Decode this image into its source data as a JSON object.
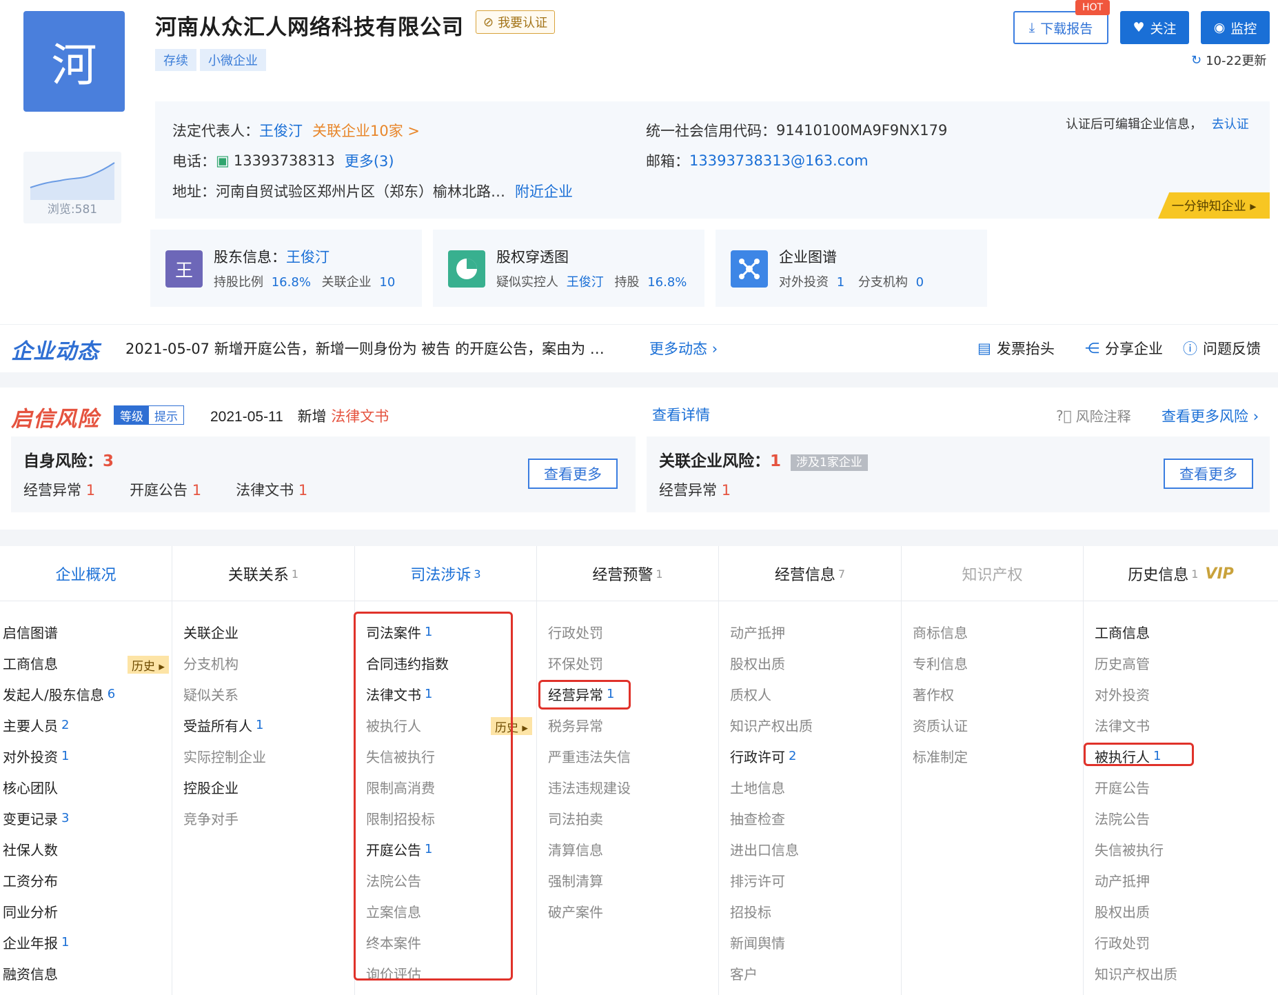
{
  "company": {
    "logo_char": "河",
    "name": "河南从众汇人网络科技有限公司",
    "verify_label": "我要认证",
    "tags": [
      "存续",
      "小微企业"
    ],
    "views": "浏览:581"
  },
  "header_actions": {
    "download": "下载报告",
    "hot": "HOT",
    "follow": "关注",
    "monitor": "监控",
    "updated": "10-22更新"
  },
  "info": {
    "legal_label": "法定代表人：",
    "legal_name": "王俊汀",
    "related": "关联企业10家 >",
    "phone_label": "电话：",
    "phone": "13393738313",
    "phone_more": "更多(3)",
    "address_label": "地址：",
    "address": "河南自贸试验区郑州片区（郑东）榆林北路…",
    "nearby": "附近企业",
    "credit_label": "统一社会信用代码：",
    "credit_code": "91410100MA9F9NX179",
    "email_label": "邮箱：",
    "email": "13393738313@163.com",
    "cert_note": "认证后可编辑企业信息，",
    "cert_link": "去认证",
    "quick": "一分钟知企业 ▸"
  },
  "cards": [
    {
      "icon_char": "王",
      "title": "股东信息：",
      "title_link": "王俊汀",
      "sub1": "持股比例",
      "val1": "16.8%",
      "sub2": "关联企业",
      "val2": "10"
    },
    {
      "title": "股权穿透图",
      "sub1": "疑似实控人",
      "val1": "王俊汀",
      "sub2": "持股",
      "val2": "16.8%"
    },
    {
      "title": "企业图谱",
      "sub1": "对外投资",
      "val1": "1",
      "sub2": "分支机构",
      "val2": "0"
    }
  ],
  "dynamics": {
    "title": "企业动态",
    "text": "2021-05-07  新增开庭公告，新增一则身份为 被告 的开庭公告，案由为 …",
    "more": "更多动态",
    "actions": [
      "发票抬头",
      "分享企业",
      "问题反馈"
    ]
  },
  "risk": {
    "title": "启信风险",
    "level": "等级",
    "hint": "提示",
    "date": "2021-05-11",
    "news_prefix": "新增",
    "news_link": "法律文书",
    "detail": "查看详情",
    "note": "风险注释",
    "more": "查看更多风险",
    "self": {
      "label": "自身风险：",
      "count": "3",
      "items": [
        [
          "经营异常",
          "1"
        ],
        [
          "开庭公告",
          "1"
        ],
        [
          "法律文书",
          "1"
        ]
      ],
      "button": "查看更多"
    },
    "related": {
      "label": "关联企业风险：",
      "count": "1",
      "badge": "涉及1家企业",
      "items": [
        [
          "经营异常",
          "1"
        ]
      ],
      "button": "查看更多"
    }
  },
  "tabs": [
    {
      "label": "企业概况",
      "count": ""
    },
    {
      "label": "关联关系",
      "count": "1"
    },
    {
      "label": "司法涉诉",
      "count": "3"
    },
    {
      "label": "经营预警",
      "count": "1"
    },
    {
      "label": "经营信息",
      "count": "7"
    },
    {
      "label": "知识产权",
      "count": ""
    },
    {
      "label": "历史信息",
      "count": "1",
      "vip": "VIP"
    }
  ],
  "hist_badge": "历史 ▸",
  "columns": [
    [
      [
        "启信图谱",
        ""
      ],
      [
        "工商信息",
        ""
      ],
      [
        "发起人/股东信息",
        "6"
      ],
      [
        "主要人员",
        "2"
      ],
      [
        "对外投资",
        "1"
      ],
      [
        "核心团队",
        ""
      ],
      [
        "变更记录",
        "3"
      ],
      [
        "社保人数",
        ""
      ],
      [
        "工资分布",
        ""
      ],
      [
        "同业分析",
        ""
      ],
      [
        "企业年报",
        "1"
      ],
      [
        "融资信息",
        ""
      ]
    ],
    [
      [
        "关联企业",
        ""
      ],
      [
        "分支机构",
        ""
      ],
      [
        "疑似关系",
        ""
      ],
      [
        "受益所有人",
        "1"
      ],
      [
        "实际控制企业",
        ""
      ],
      [
        "控股企业",
        ""
      ],
      [
        "竞争对手",
        ""
      ]
    ],
    [
      [
        "司法案件",
        "1"
      ],
      [
        "合同违约指数",
        ""
      ],
      [
        "法律文书",
        "1"
      ],
      [
        "被执行人",
        ""
      ],
      [
        "失信被执行",
        ""
      ],
      [
        "限制高消费",
        ""
      ],
      [
        "限制招投标",
        ""
      ],
      [
        "开庭公告",
        "1"
      ],
      [
        "法院公告",
        ""
      ],
      [
        "立案信息",
        ""
      ],
      [
        "终本案件",
        ""
      ],
      [
        "询价评估",
        ""
      ]
    ],
    [
      [
        "行政处罚",
        ""
      ],
      [
        "环保处罚",
        ""
      ],
      [
        "经营异常",
        "1"
      ],
      [
        "税务异常",
        ""
      ],
      [
        "严重违法失信",
        ""
      ],
      [
        "违法违规建设",
        ""
      ],
      [
        "司法拍卖",
        ""
      ],
      [
        "清算信息",
        ""
      ],
      [
        "强制清算",
        ""
      ],
      [
        "破产案件",
        ""
      ]
    ],
    [
      [
        "动产抵押",
        ""
      ],
      [
        "股权出质",
        ""
      ],
      [
        "质权人",
        ""
      ],
      [
        "知识产权出质",
        ""
      ],
      [
        "行政许可",
        "2"
      ],
      [
        "土地信息",
        ""
      ],
      [
        "抽查检查",
        ""
      ],
      [
        "进出口信息",
        ""
      ],
      [
        "排污许可",
        ""
      ],
      [
        "招投标",
        ""
      ],
      [
        "新闻舆情",
        ""
      ],
      [
        "客户",
        ""
      ]
    ],
    [
      [
        "商标信息",
        ""
      ],
      [
        "专利信息",
        ""
      ],
      [
        "著作权",
        ""
      ],
      [
        "资质认证",
        ""
      ],
      [
        "标准制定",
        ""
      ]
    ],
    [
      [
        "工商信息",
        ""
      ],
      [
        "历史高管",
        ""
      ],
      [
        "对外投资",
        ""
      ],
      [
        "法律文书",
        ""
      ],
      [
        "被执行人",
        "1"
      ],
      [
        "开庭公告",
        ""
      ],
      [
        "法院公告",
        ""
      ],
      [
        "失信被执行",
        ""
      ],
      [
        "动产抵押",
        ""
      ],
      [
        "股权出质",
        ""
      ],
      [
        "行政处罚",
        ""
      ],
      [
        "知识产权出质",
        ""
      ]
    ]
  ],
  "colors": {
    "brand_blue": "#1a6fd6",
    "risk_red": "#e5533f",
    "highlight": "#e0322a"
  }
}
